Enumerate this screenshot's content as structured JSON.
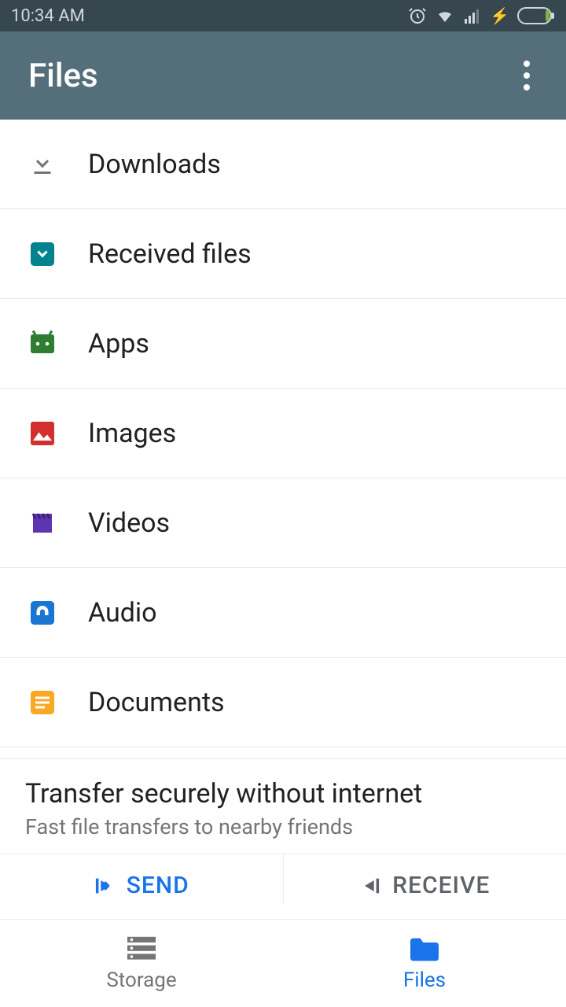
{
  "status": {
    "time": "10:34 AM"
  },
  "appbar": {
    "title": "Files"
  },
  "categories": [
    {
      "icon": "download",
      "label": "Downloads"
    },
    {
      "icon": "received",
      "label": "Received files"
    },
    {
      "icon": "apps",
      "label": "Apps"
    },
    {
      "icon": "images",
      "label": "Images"
    },
    {
      "icon": "videos",
      "label": "Videos"
    },
    {
      "icon": "audio",
      "label": "Audio"
    },
    {
      "icon": "documents",
      "label": "Documents"
    }
  ],
  "transfer": {
    "title": "Transfer securely without internet",
    "subtitle": "Fast file transfers to nearby friends",
    "send": "SEND",
    "receive": "RECEIVE"
  },
  "nav": {
    "storage": "Storage",
    "files": "Files"
  }
}
